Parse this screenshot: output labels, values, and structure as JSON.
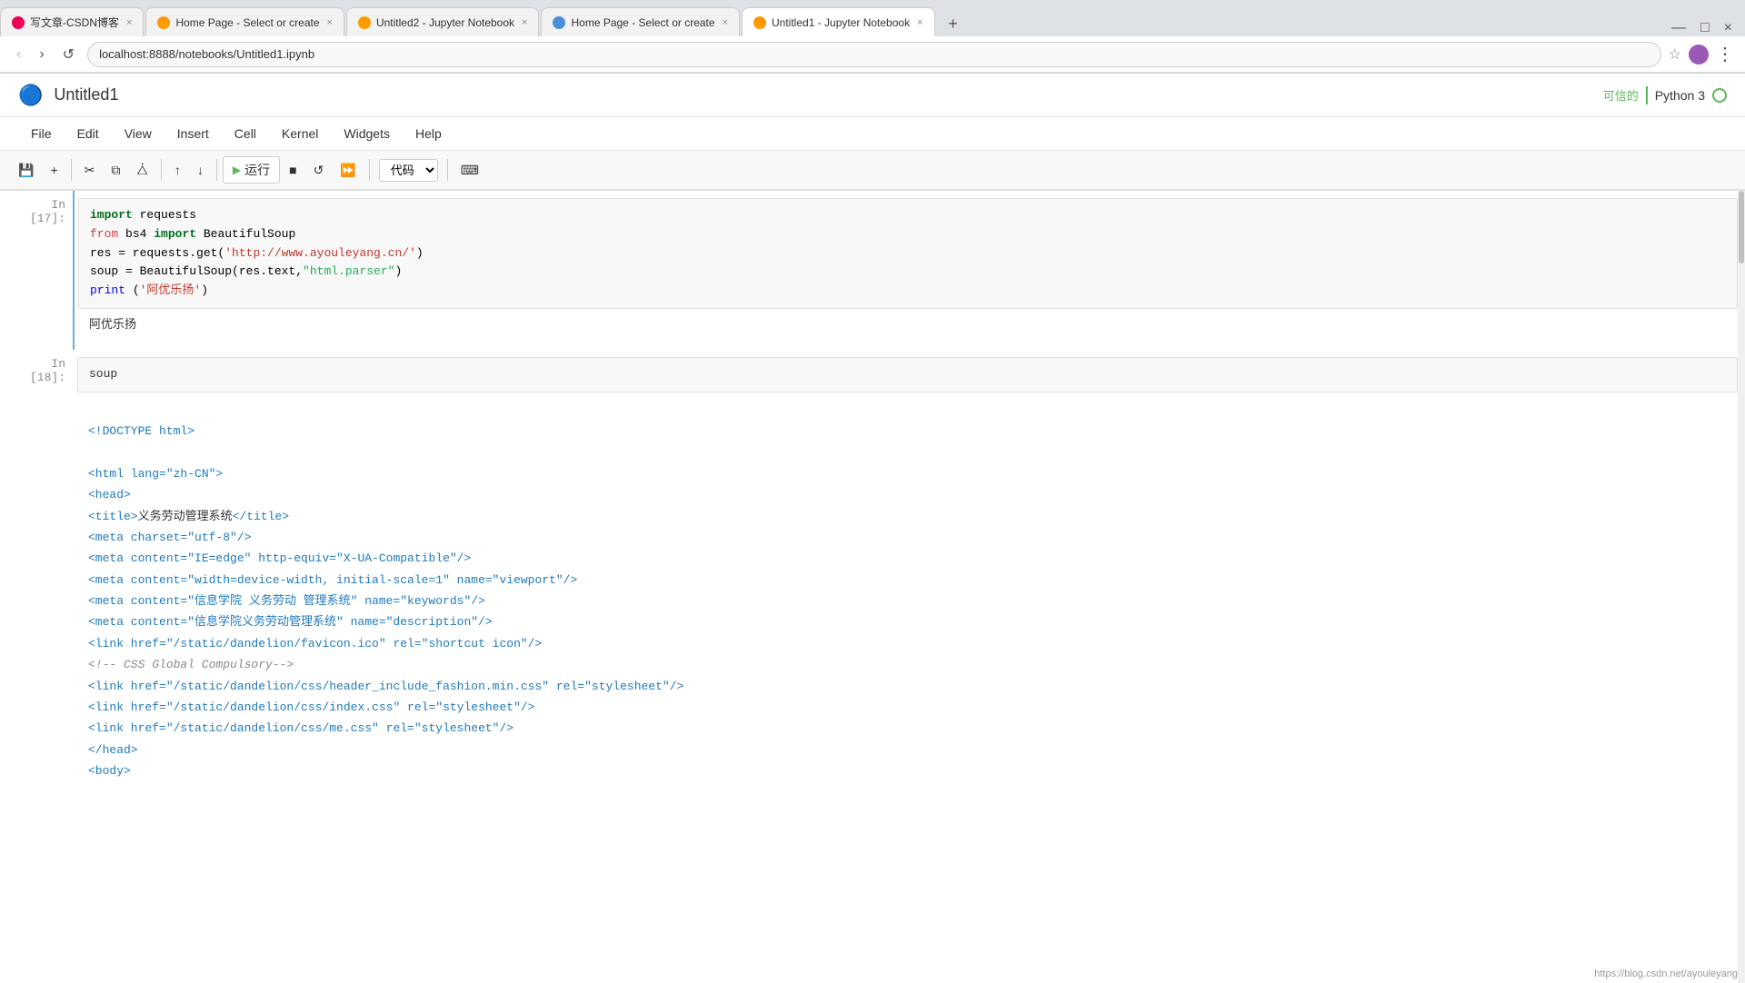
{
  "browser": {
    "tabs": [
      {
        "id": "tab1",
        "label": "写文章-CSDN博客",
        "icon_color": "red",
        "active": false
      },
      {
        "id": "tab2",
        "label": "Home Page - Select or create",
        "icon_color": "orange",
        "active": false
      },
      {
        "id": "tab3",
        "label": "Untitled2 - Jupyter Notebook",
        "icon_color": "orange",
        "active": false
      },
      {
        "id": "tab4",
        "label": "Home Page - Select or create",
        "icon_color": "blue",
        "active": false
      },
      {
        "id": "tab5",
        "label": "Untitled1 - Jupyter Notebook",
        "icon_color": "orange",
        "active": true
      }
    ],
    "url": "localhost:8888/notebooks/Untitled1.ipynb",
    "new_tab_label": "+",
    "window_controls": [
      "—",
      "□",
      "×"
    ]
  },
  "jupyter": {
    "title": "Untitled1",
    "menu_items": [
      "File",
      "Edit",
      "View",
      "Insert",
      "Cell",
      "Kernel",
      "Widgets",
      "Help"
    ],
    "toolbar": {
      "save": "💾",
      "add_cell": "+",
      "cut": "✂",
      "copy": "⧉",
      "paste": "⧊",
      "move_up": "↑",
      "move_down": "↓",
      "run_label": "运行",
      "stop": "■",
      "restart": "↺",
      "restart_run": "⏩",
      "cell_type": "代码",
      "keyboard": "⌨"
    },
    "kernel": {
      "trusted_label": "可信的",
      "name": "Python 3"
    }
  },
  "cells": [
    {
      "id": "cell17",
      "prompt": "In [17]:",
      "type": "code",
      "code_lines": [
        {
          "parts": [
            {
              "text": "import",
              "class": "kw-green"
            },
            {
              "text": " requests",
              "class": "code-plain"
            }
          ]
        },
        {
          "parts": [
            {
              "text": "from",
              "class": "kw-magenta"
            },
            {
              "text": " bs4 ",
              "class": "code-plain"
            },
            {
              "text": "import",
              "class": "kw-green"
            },
            {
              "text": " BeautifulSoup",
              "class": "code-plain"
            }
          ]
        },
        {
          "parts": [
            {
              "text": "res",
              "class": "code-plain"
            },
            {
              "text": " = requests.get(",
              "class": "code-plain"
            },
            {
              "text": "'http://www.ayouleyang.cn/'",
              "class": "str-red"
            },
            {
              "text": ")",
              "class": "code-plain"
            }
          ]
        },
        {
          "parts": [
            {
              "text": "soup",
              "class": "code-plain"
            },
            {
              "text": " = BeautifulSoup(res.text,",
              "class": "code-plain"
            },
            {
              "text": "\"html.parser\"",
              "class": "str-green"
            },
            {
              "text": ")",
              "class": "code-plain"
            }
          ]
        },
        {
          "parts": [
            {
              "text": "print",
              "class": "kw-blue"
            },
            {
              "text": " (",
              "class": "code-plain"
            },
            {
              "text": "'阿优乐扬'",
              "class": "str-red"
            },
            {
              "text": ")",
              "class": "code-plain"
            }
          ]
        }
      ],
      "output": "阿优乐扬"
    },
    {
      "id": "cell18",
      "prompt": "In [18]:",
      "type": "code",
      "code_lines": [
        {
          "parts": [
            {
              "text": "soup",
              "class": "code-plain"
            }
          ]
        }
      ],
      "output_html": [
        "<!DOCTYPE html>",
        "",
        "<html lang=\"zh-CN\">",
        "<head>",
        "<title>义务劳动管理系统</title>",
        "<meta charset=\"utf-8\"/>",
        "<meta content=\"IE=edge\" http-equiv=\"X-UA-Compatible\"/>",
        "<meta content=\"width=device-width, initial-scale=1\" name=\"viewport\"/>",
        "<meta content=\"信息学院 义务劳动 管理系统\" name=\"keywords\"/>",
        "<meta content=\"信息学院义务劳动管理系统\" name=\"description\"/>",
        "<link href=\"/static/dandelion/favicon.ico\" rel=\"shortcut icon\"/>",
        "<!-- CSS Global Compulsory-->",
        "<link href=\"/static/dandelion/css/header_include_fashion.min.css\" rel=\"stylesheet\"/>",
        "<link href=\"/static/dandelion/css/index.css\" rel=\"stylesheet\"/>",
        "<link href=\"/static/dandelion/css/me.css\" rel=\"stylesheet\"/>",
        "</head>",
        "<body>"
      ]
    }
  ],
  "status_bar": {
    "url": "https://blog.csdn.net/ayouleyang"
  }
}
